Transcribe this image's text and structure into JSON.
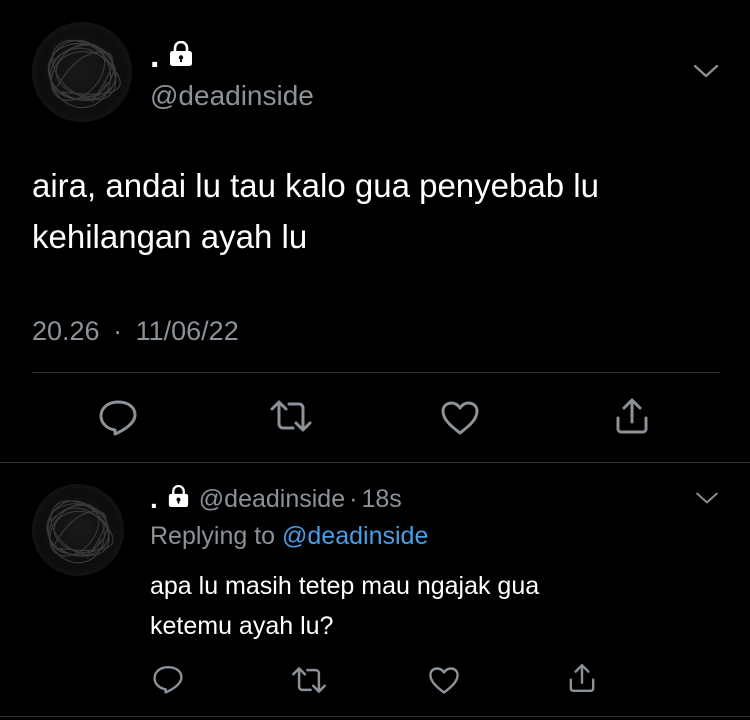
{
  "main_tweet": {
    "display_name": ".",
    "handle": "@deadinside",
    "text": "aira, andai lu tau kalo gua penyebab lu kehilangan ayah lu",
    "time": "20.26",
    "separator": "·",
    "date": "11/06/22",
    "actions": [
      {
        "name": "reply",
        "icon": "comment-icon"
      },
      {
        "name": "retweet",
        "icon": "retweet-icon"
      },
      {
        "name": "like",
        "icon": "heart-icon"
      },
      {
        "name": "share",
        "icon": "share-icon"
      }
    ]
  },
  "reply_tweet": {
    "display_name": ".",
    "handle": "@deadinside",
    "separator": "·",
    "age": "18s",
    "replying_prefix": "Replying to",
    "replying_handle": "@deadinside",
    "text_line1": "apa lu masih tetep mau ngajak gua",
    "text_line2": "ketemu ayah lu?",
    "actions": [
      {
        "name": "reply",
        "icon": "comment-icon"
      },
      {
        "name": "retweet",
        "icon": "retweet-icon"
      },
      {
        "name": "like",
        "icon": "heart-icon"
      },
      {
        "name": "share",
        "icon": "share-icon"
      }
    ]
  },
  "colors": {
    "background": "#000000",
    "text": "#ffffff",
    "muted": "#8b9299",
    "link": "#4a9ee8",
    "divider": "#2f3336"
  }
}
